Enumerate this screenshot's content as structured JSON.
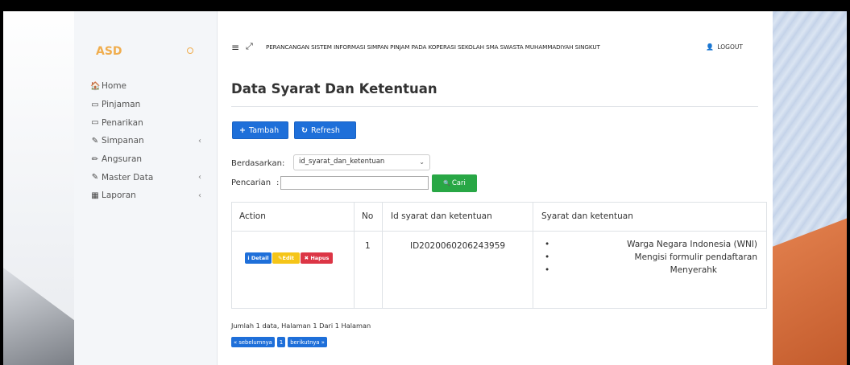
{
  "sidebar": {
    "brand": "ASD",
    "brand_indicator_icon": "circle-icon",
    "items": [
      {
        "icon": "home-icon",
        "glyph": "🏠",
        "label": "Home",
        "caret": ""
      },
      {
        "icon": "card-icon",
        "glyph": "▭",
        "label": "Pinjaman",
        "caret": ""
      },
      {
        "icon": "card-icon",
        "glyph": "▭",
        "label": "Penarikan",
        "caret": ""
      },
      {
        "icon": "edit-icon",
        "glyph": "✎",
        "label": "Simpanan",
        "caret": "‹"
      },
      {
        "icon": "pencil-icon",
        "glyph": "✏",
        "label": "Angsuran",
        "caret": ""
      },
      {
        "icon": "edit-icon",
        "glyph": "✎",
        "label": "Master Data",
        "caret": "‹"
      },
      {
        "icon": "calendar-icon",
        "glyph": "▦",
        "label": "Laporan",
        "caret": "‹"
      }
    ]
  },
  "topbar": {
    "menu_glyph": "≡",
    "expand_glyph": "⤢",
    "title": "PERANCANGAN SISTEM INFORMASI SIMPAN PINJAM PADA KOPERASI SEKOLAH SMA SWASTA MUHAMMADIYAH SINGKUT",
    "logout_label": "LOGOUT",
    "logout_glyph": "👤"
  },
  "page": {
    "title": "Data Syarat Dan Ketentuan",
    "add_button": "Tambah",
    "add_glyph": "+",
    "refresh_button": "Refresh",
    "refresh_glyph": "↻"
  },
  "filter": {
    "by_label": "Berdasarkan:",
    "by_value": "id_syarat_dan_ketentuan",
    "search_label": "Pencarian",
    "search_colon": ":",
    "search_value": "",
    "search_button": "Cari",
    "search_glyph": "🔍"
  },
  "table": {
    "headers": [
      "Action",
      "No",
      "Id syarat dan ketentuan",
      "Syarat dan ketentuan"
    ],
    "rows": [
      {
        "actions": {
          "detail": "Detail",
          "edit": "Edit",
          "hapus": "Hapus"
        },
        "no": "1",
        "id": "ID2020060206243959",
        "items": [
          "Warga Negara Indonesia (WNI)",
          "Mengisi formulir pendaftaran",
          "Menyerahk"
        ]
      }
    ]
  },
  "footer": {
    "summary": "Jumlah 1 data, Halaman 1 Dari 1 Halaman",
    "prev": "« sebelumnya",
    "page": "1",
    "next": "berikutnya »"
  },
  "colors": {
    "primary": "#1e6fd9",
    "success": "#28a745",
    "warning": "#f5c518",
    "danger": "#dc3545",
    "brand": "#f0ad4e"
  }
}
